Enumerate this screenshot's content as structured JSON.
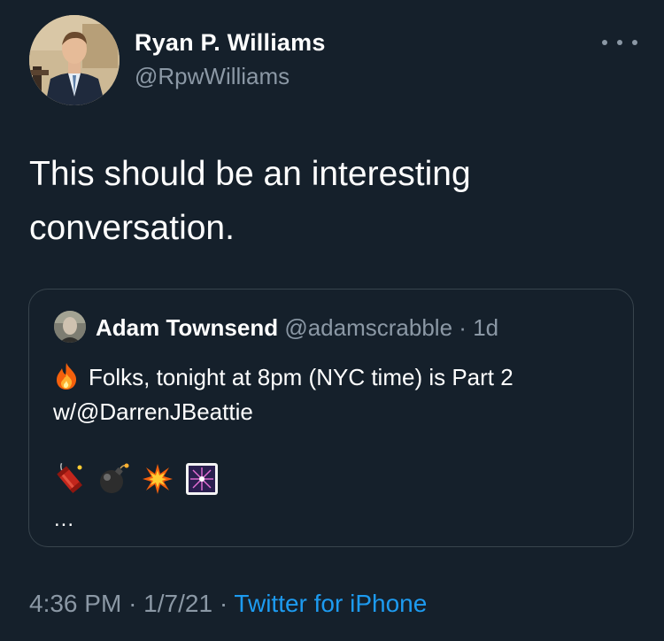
{
  "tweet": {
    "author": {
      "name": "Ryan P. Williams",
      "handle": "@RpwWilliams"
    },
    "text": "This should be an interesting conversation.",
    "quoted": {
      "author_name": "Adam Townsend",
      "handle": "@adamscrabble",
      "separator": "·",
      "time": "1d",
      "lead_emoji": "fire-emoji",
      "text": "Folks, tonight at 8pm (NYC time) is Part 2 w/@DarrenJBeattie",
      "emojis": [
        "firecracker-emoji",
        "bomb-emoji",
        "collision-emoji",
        "sparkler-emoji"
      ],
      "ellipsis": "..."
    },
    "meta": {
      "time": "4:36 PM",
      "separator": "·",
      "date": "1/7/21",
      "source": "Twitter for iPhone"
    }
  },
  "colors": {
    "background": "#15202b",
    "secondary_text": "#8b98a5",
    "link": "#1d9bf0",
    "border": "#38444d"
  }
}
